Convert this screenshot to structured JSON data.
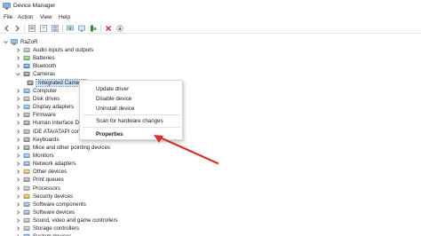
{
  "window": {
    "title": "Device Manager",
    "icon": "device-manager-icon"
  },
  "menu": [
    "File",
    "Action",
    "View",
    "Help"
  ],
  "toolbar": {
    "buttons": [
      "back-icon",
      "forward-icon",
      "properties-view-icon",
      "help-list-icon",
      "help-icon",
      "update-driver-icon",
      "scan-monitor-icon",
      "enable-device-icon",
      "uninstall-icon",
      "download-icon"
    ]
  },
  "tree": {
    "root": "RaZoR",
    "items": [
      {
        "label": "Audio inputs and outputs",
        "icon": "speaker-icon"
      },
      {
        "label": "Batteries",
        "icon": "battery-icon"
      },
      {
        "label": "Bluetooth",
        "icon": "bluetooth-icon"
      },
      {
        "label": "Cameras",
        "icon": "camera-icon",
        "expanded": true
      },
      {
        "label": "Integrated Camera",
        "icon": "camera-icon",
        "child": true,
        "selected": true
      },
      {
        "label": "Computer",
        "icon": "computer-icon"
      },
      {
        "label": "Disk drives",
        "icon": "disk-icon"
      },
      {
        "label": "Display adapters",
        "icon": "display-icon"
      },
      {
        "label": "Firmware",
        "icon": "firmware-icon"
      },
      {
        "label": "Human Interface Devices",
        "icon": "hid-icon"
      },
      {
        "label": "IDE ATA/ATAPI controllers",
        "icon": "ide-icon"
      },
      {
        "label": "Keyboards",
        "icon": "keyboard-icon"
      },
      {
        "label": "Mice and other pointing devices",
        "icon": "mouse-icon"
      },
      {
        "label": "Monitors",
        "icon": "monitor-icon"
      },
      {
        "label": "Network adapters",
        "icon": "network-icon"
      },
      {
        "label": "Other devices",
        "icon": "other-device-icon"
      },
      {
        "label": "Print queues",
        "icon": "printer-icon"
      },
      {
        "label": "Processors",
        "icon": "processor-icon"
      },
      {
        "label": "Security devices",
        "icon": "security-icon"
      },
      {
        "label": "Software components",
        "icon": "software-icon"
      },
      {
        "label": "Software devices",
        "icon": "software-icon"
      },
      {
        "label": "Sound, video and game controllers",
        "icon": "speaker-icon"
      },
      {
        "label": "Storage controllers",
        "icon": "storage-icon"
      },
      {
        "label": "System devices",
        "icon": "system-icon"
      }
    ]
  },
  "context_menu": {
    "items": [
      "Update driver",
      "Disable device",
      "Uninstall device",
      "Scan for hardware changes",
      "Properties"
    ]
  },
  "colors": {
    "accent_arrow": "#d9302c",
    "selection": "#cfe2f7"
  }
}
